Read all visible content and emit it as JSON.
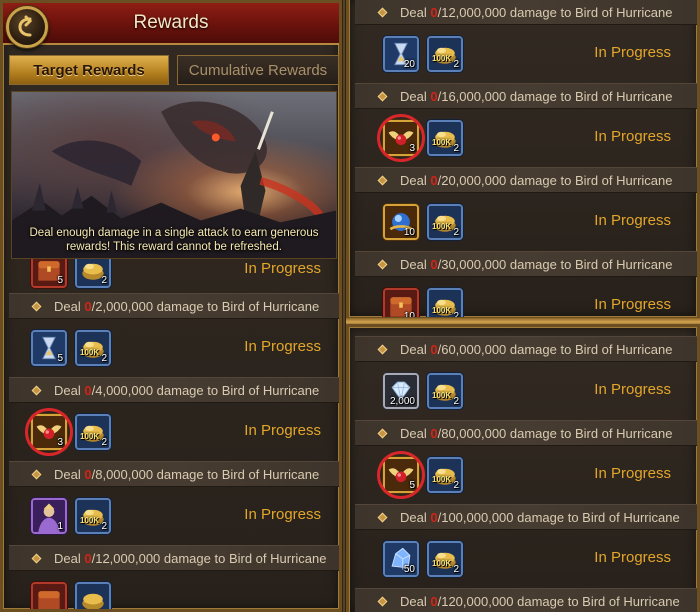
{
  "left_panel": {
    "title": "Rewards",
    "tabs": [
      {
        "label": "Target Rewards",
        "active": true
      },
      {
        "label": "Cumulative Rewards",
        "active": false
      }
    ],
    "banner_caption": "Deal enough damage in a single attack to earn generous rewards! This reward cannot be refreshed.",
    "partial_reward": {
      "qty_a": "5",
      "qty_b": "2",
      "status": "In Progress"
    },
    "tasks": [
      {
        "zero": "0",
        "text": "/2,000,000 damage to Bird of Hurricane",
        "items": [
          {
            "icon": "hourglass-icon",
            "qty": "5"
          },
          {
            "icon": "gold-coins-icon",
            "qty": "2",
            "badge": "100K"
          }
        ],
        "status": "In Progress",
        "circled": false
      },
      {
        "zero": "0",
        "text": "/4,000,000 damage to Bird of Hurricane",
        "items": [
          {
            "icon": "winged-gem-icon",
            "qty": "3"
          },
          {
            "icon": "gold-coins-icon",
            "qty": "2",
            "badge": "100K"
          }
        ],
        "status": "In Progress",
        "circled": true
      },
      {
        "zero": "0",
        "text": "/8,000,000 damage to Bird of Hurricane",
        "items": [
          {
            "icon": "hero-portrait-icon",
            "qty": "1"
          },
          {
            "icon": "gold-coins-icon",
            "qty": "2",
            "badge": "100K"
          }
        ],
        "status": "In Progress",
        "circled": false
      },
      {
        "zero": "0",
        "text": "/12,000,000 damage to Bird of Hurricane"
      }
    ],
    "deal_word": "Deal"
  },
  "right_top_panel": {
    "tasks": [
      {
        "zero": "0",
        "text": "/12,000,000 damage to Bird of Hurricane",
        "items": [
          {
            "icon": "hourglass-icon",
            "qty": "20"
          },
          {
            "icon": "gold-coins-icon",
            "qty": "2",
            "badge": "100K"
          }
        ],
        "status": "In Progress",
        "circled": false
      },
      {
        "zero": "0",
        "text": "/16,000,000 damage to Bird of Hurricane",
        "items": [
          {
            "icon": "winged-gem-icon",
            "qty": "3"
          },
          {
            "icon": "gold-coins-icon",
            "qty": "2",
            "badge": "100K"
          }
        ],
        "status": "In Progress",
        "circled": true
      },
      {
        "zero": "0",
        "text": "/20,000,000 damage to Bird of Hurricane",
        "items": [
          {
            "icon": "orb-icon",
            "qty": "10"
          },
          {
            "icon": "gold-coins-icon",
            "qty": "2",
            "badge": "100K"
          }
        ],
        "status": "In Progress",
        "circled": false
      },
      {
        "zero": "0",
        "text": "/30,000,000 damage to Bird of Hurricane",
        "items": [
          {
            "icon": "treasure-chest-icon",
            "qty": "10"
          },
          {
            "icon": "gold-coins-icon",
            "qty": "2",
            "badge": "100K"
          }
        ],
        "status": "In Progress",
        "circled": false
      }
    ],
    "deal_word": "Deal"
  },
  "right_bottom_panel": {
    "tasks": [
      {
        "zero": "0",
        "text": "/60,000,000 damage to Bird of Hurricane",
        "items": [
          {
            "icon": "diamond-icon",
            "qty": "2,000"
          },
          {
            "icon": "gold-coins-icon",
            "qty": "2",
            "badge": "100K"
          }
        ],
        "status": "In Progress",
        "circled": false
      },
      {
        "zero": "0",
        "text": "/80,000,000 damage to Bird of Hurricane",
        "items": [
          {
            "icon": "winged-gem-icon",
            "qty": "5"
          },
          {
            "icon": "gold-coins-icon",
            "qty": "2",
            "badge": "100K"
          }
        ],
        "status": "In Progress",
        "circled": true
      },
      {
        "zero": "0",
        "text": "/100,000,000 damage to Bird of Hurricane",
        "items": [
          {
            "icon": "crystal-ore-icon",
            "qty": "50"
          },
          {
            "icon": "gold-coins-icon",
            "qty": "2",
            "badge": "100K"
          }
        ],
        "status": "In Progress",
        "circled": false
      },
      {
        "zero": "0",
        "text": "/120,000,000 damage to Bird of Hurricane"
      }
    ],
    "deal_word": "Deal"
  },
  "colors": {
    "accent_gold": "#e3a62a",
    "title_red": "#8e1e14",
    "progress_zero": "#d22418",
    "highlight_ring": "#d9262a"
  }
}
